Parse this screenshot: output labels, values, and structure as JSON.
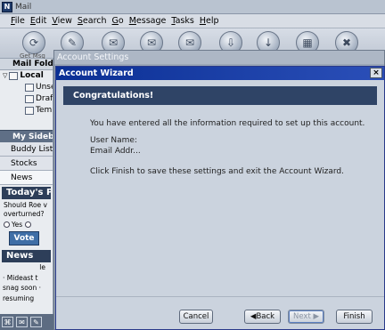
{
  "app": {
    "title": "Mail",
    "icon": "N"
  },
  "menu": [
    "File",
    "Edit",
    "View",
    "Search",
    "Go",
    "Message",
    "Tasks",
    "Help"
  ],
  "toolbar": {
    "get_msgs_label": "Get Msg",
    "buttons": [
      "get-messages-icon",
      "compose-icon",
      "reply-icon",
      "reply-all-icon",
      "forward-icon",
      "file-icon",
      "next-icon",
      "delete-icon",
      "stop-icon"
    ]
  },
  "left_panel": {
    "header": "Mail Folders",
    "tree": [
      "Local",
      "Unsent",
      "Drafts",
      "Templates"
    ],
    "sidebar_header": "My Sidebar",
    "tabs": [
      "Buddy List",
      "Stocks",
      "News"
    ],
    "todays_poll": "Today's Poll",
    "poll_question_1": "Should Roe v",
    "poll_question_2": "overturned?",
    "poll_yes": "Yes",
    "vote_label": "Vote",
    "news_header": "News",
    "news_lines": [
      "le",
      "· Mideast t",
      "snag soon ·",
      "resuming"
    ]
  },
  "account_settings": {
    "title": "Account Settings"
  },
  "wizard": {
    "title": "Account Wizard",
    "close": "×",
    "heading": "Congratulations!",
    "intro": "You have entered all the information required to set up this account.",
    "user_name_label": "User Name:",
    "email_label": "Email Addr...",
    "finish_note": "Click Finish to save these settings and exit the Account Wizard.",
    "buttons": {
      "cancel": "Cancel",
      "back": "◀Back",
      "next": "Next ▶",
      "finish": "Finish"
    }
  }
}
